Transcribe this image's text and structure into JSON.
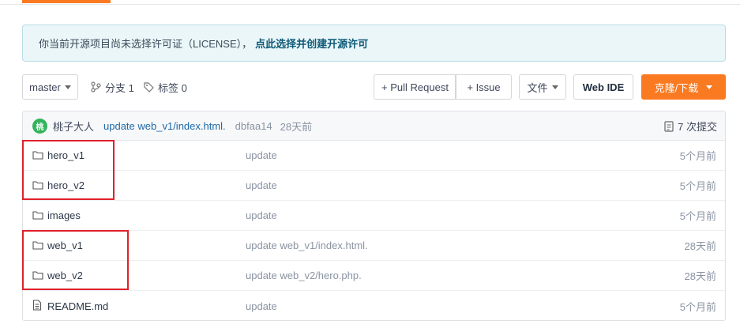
{
  "notice": {
    "text": "你当前开源项目尚未选择许可证（LICENSE），",
    "link": "点此选择并创建开源许可"
  },
  "toolbar": {
    "branch": "master",
    "branches": "分支 1",
    "tags": "标签 0",
    "pull_request": "+ Pull Request",
    "issue": "+ Issue",
    "file": "文件",
    "web_ide": "Web IDE",
    "clone": "克隆/下载"
  },
  "commit": {
    "avatar_letter": "桃",
    "author": "桃子大人",
    "message": "update web_v1/index.html.",
    "sha": "dbfaa14",
    "time": "28天前",
    "count": "7 次提交"
  },
  "files": [
    {
      "type": "folder",
      "name": "hero_v1",
      "message": "update",
      "time": "5个月前"
    },
    {
      "type": "folder",
      "name": "hero_v2",
      "message": "update",
      "time": "5个月前"
    },
    {
      "type": "folder",
      "name": "images",
      "message": "update",
      "time": "5个月前"
    },
    {
      "type": "folder",
      "name": "web_v1",
      "message": "update web_v1/index.html.",
      "time": "28天前"
    },
    {
      "type": "folder",
      "name": "web_v2",
      "message": "update web_v2/hero.php.",
      "time": "28天前"
    },
    {
      "type": "file",
      "name": "README.md",
      "message": "update",
      "time": "5个月前"
    }
  ],
  "colors": {
    "accent": "#fa7a22",
    "highlight": "#e0212b",
    "notice_bg": "#eaf6f8"
  }
}
